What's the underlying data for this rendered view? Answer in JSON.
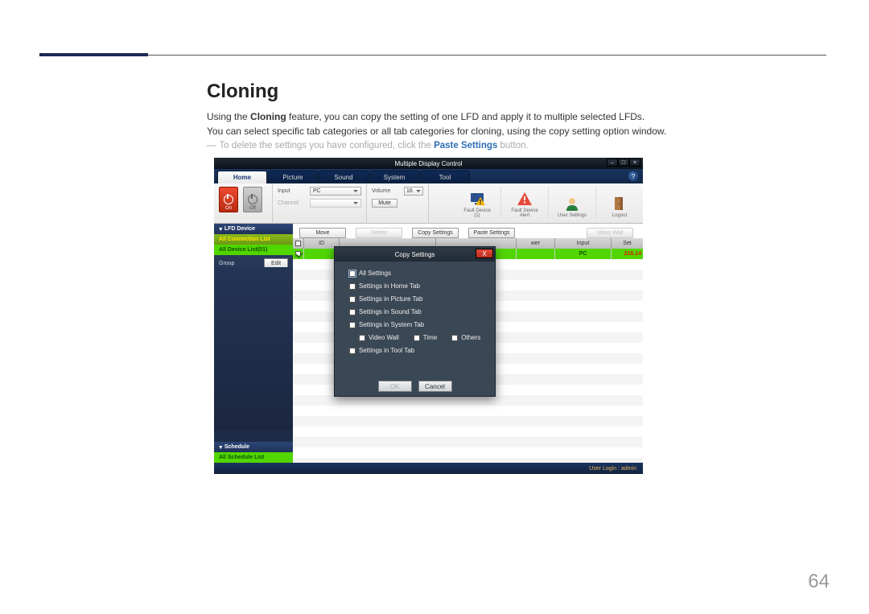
{
  "doc": {
    "heading": "Cloning",
    "para1_a": "Using the ",
    "para1_b": "Cloning",
    "para1_c": " feature, you can copy the setting of one LFD and apply it to multiple selected LFDs.",
    "para2": "You can select specific tab categories or all tab categories for cloning, using the copy setting option window.",
    "note_a": "To delete the settings you have configured, click the ",
    "note_b": "Paste Settings",
    "note_c": " button.",
    "page_num": "64"
  },
  "app": {
    "title": "Multiple Display Control",
    "win_min": "–",
    "win_max": "□",
    "win_close": "×",
    "help": "?",
    "tabs": [
      "Home",
      "Picture",
      "Sound",
      "System",
      "Tool"
    ],
    "toolbar": {
      "on": "On",
      "off": "Off",
      "input_label": "Input",
      "input_value": "PC",
      "channel_label": "Channel",
      "volume_label": "Volume",
      "volume_value": "16",
      "mute": "Mute",
      "icons": [
        {
          "label": "Fault Device\n(1)"
        },
        {
          "label": "Fault Device\nAlert"
        },
        {
          "label": "User Settings"
        },
        {
          "label": "Logout"
        }
      ]
    },
    "actions": {
      "move": "Move",
      "delete": "Delete",
      "copy": "Copy Settings",
      "paste": "Paste Settings",
      "video": "Video Wall"
    },
    "sidebar": {
      "lfd_device": "LFD Device",
      "all_conn": "All Connection List",
      "all_dev": "All Device List(01)",
      "group": "Group",
      "edit": "Edit",
      "schedule": "Schedule",
      "all_sched": "All Schedule List"
    },
    "grid": {
      "headers": [
        "",
        "ID",
        "",
        "",
        "wer",
        "Input",
        "Set"
      ],
      "row": [
        "",
        "",
        "",
        "",
        "",
        "PC",
        "216.14"
      ]
    },
    "status": "User Login : admin",
    "modal": {
      "title": "Copy Settings",
      "close": "X",
      "opts": [
        "All Settings",
        "Settings in Home Tab",
        "Settings in Picture Tab",
        "Settings in Sound Tab",
        "Settings in System Tab"
      ],
      "sub": [
        "Video Wall",
        "Time",
        "Others"
      ],
      "last": "Settings in Tool Tab",
      "ok": "OK",
      "cancel": "Cancel"
    }
  }
}
